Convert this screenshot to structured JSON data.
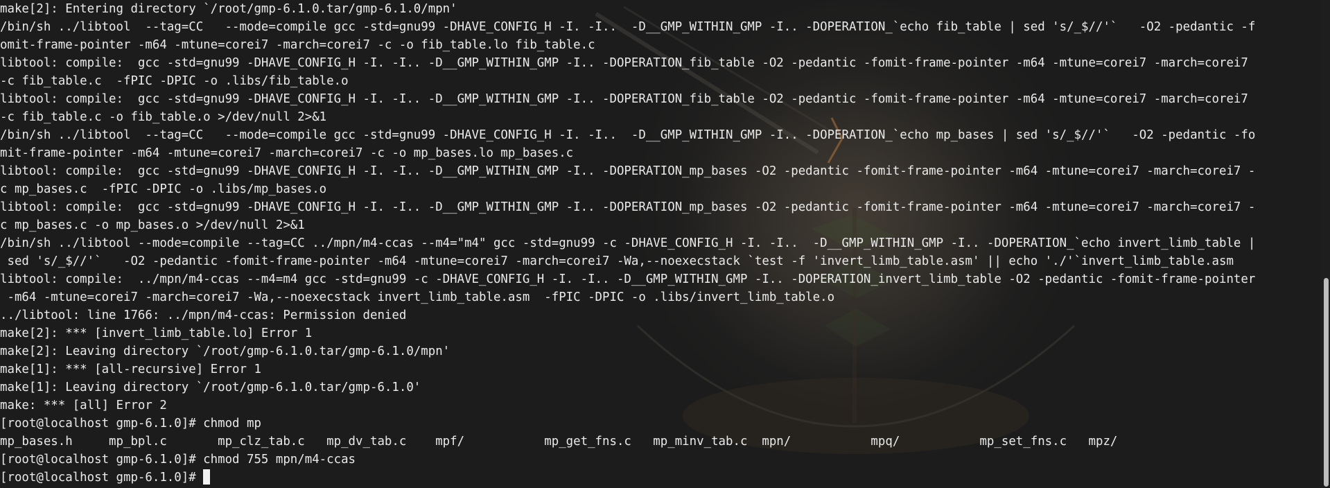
{
  "terminal": {
    "lines": [
      "make[2]: Entering directory `/root/gmp-6.1.0.tar/gmp-6.1.0/mpn'",
      "/bin/sh ../libtool  --tag=CC   --mode=compile gcc -std=gnu99 -DHAVE_CONFIG_H -I. -I..  -D__GMP_WITHIN_GMP -I.. -DOPERATION_`echo fib_table | sed 's/_$//'`   -O2 -pedantic -f",
      "omit-frame-pointer -m64 -mtune=corei7 -march=corei7 -c -o fib_table.lo fib_table.c",
      "libtool: compile:  gcc -std=gnu99 -DHAVE_CONFIG_H -I. -I.. -D__GMP_WITHIN_GMP -I.. -DOPERATION_fib_table -O2 -pedantic -fomit-frame-pointer -m64 -mtune=corei7 -march=corei7",
      "-c fib_table.c  -fPIC -DPIC -o .libs/fib_table.o",
      "libtool: compile:  gcc -std=gnu99 -DHAVE_CONFIG_H -I. -I.. -D__GMP_WITHIN_GMP -I.. -DOPERATION_fib_table -O2 -pedantic -fomit-frame-pointer -m64 -mtune=corei7 -march=corei7",
      "-c fib_table.c -o fib_table.o >/dev/null 2>&1",
      "/bin/sh ../libtool  --tag=CC   --mode=compile gcc -std=gnu99 -DHAVE_CONFIG_H -I. -I..  -D__GMP_WITHIN_GMP -I.. -DOPERATION_`echo mp_bases | sed 's/_$//'`   -O2 -pedantic -fo",
      "mit-frame-pointer -m64 -mtune=corei7 -march=corei7 -c -o mp_bases.lo mp_bases.c",
      "libtool: compile:  gcc -std=gnu99 -DHAVE_CONFIG_H -I. -I.. -D__GMP_WITHIN_GMP -I.. -DOPERATION_mp_bases -O2 -pedantic -fomit-frame-pointer -m64 -mtune=corei7 -march=corei7 -",
      "c mp_bases.c  -fPIC -DPIC -o .libs/mp_bases.o",
      "libtool: compile:  gcc -std=gnu99 -DHAVE_CONFIG_H -I. -I.. -D__GMP_WITHIN_GMP -I.. -DOPERATION_mp_bases -O2 -pedantic -fomit-frame-pointer -m64 -mtune=corei7 -march=corei7 -",
      "c mp_bases.c -o mp_bases.o >/dev/null 2>&1",
      "/bin/sh ../libtool --mode=compile --tag=CC ../mpn/m4-ccas --m4=\"m4\" gcc -std=gnu99 -c -DHAVE_CONFIG_H -I. -I..  -D__GMP_WITHIN_GMP -I.. -DOPERATION_`echo invert_limb_table |",
      " sed 's/_$//'`   -O2 -pedantic -fomit-frame-pointer -m64 -mtune=corei7 -march=corei7 -Wa,--noexecstack `test -f 'invert_limb_table.asm' || echo './'`invert_limb_table.asm",
      "libtool: compile:  ../mpn/m4-ccas --m4=m4 gcc -std=gnu99 -c -DHAVE_CONFIG_H -I. -I.. -D__GMP_WITHIN_GMP -I.. -DOPERATION_invert_limb_table -O2 -pedantic -fomit-frame-pointer",
      " -m64 -mtune=corei7 -march=corei7 -Wa,--noexecstack invert_limb_table.asm  -fPIC -DPIC -o .libs/invert_limb_table.o",
      "../libtool: line 1766: ../mpn/m4-ccas: Permission denied",
      "make[2]: *** [invert_limb_table.lo] Error 1",
      "make[2]: Leaving directory `/root/gmp-6.1.0.tar/gmp-6.1.0/mpn'",
      "make[1]: *** [all-recursive] Error 1",
      "make[1]: Leaving directory `/root/gmp-6.1.0.tar/gmp-6.1.0'",
      "make: *** [all] Error 2",
      "[root@localhost gmp-6.1.0]# chmod mp",
      "mp_bases.h     mp_bpl.c       mp_clz_tab.c   mp_dv_tab.c    mpf/           mp_get_fns.c   mp_minv_tab.c  mpn/           mpq/           mp_set_fns.c   mpz/",
      "[root@localhost gmp-6.1.0]# chmod 755 mpn/m4-ccas"
    ],
    "prompt": "[root@localhost gmp-6.1.0]# ",
    "scrollbar": {
      "thumb_start": 0.57,
      "thumb_end": 1.0
    },
    "colors": {
      "background": "#1c1c1c",
      "text": "#eaeaea",
      "cursor": "#f2f2f2",
      "scrollbar_thumb": "#bdbdbd"
    }
  }
}
